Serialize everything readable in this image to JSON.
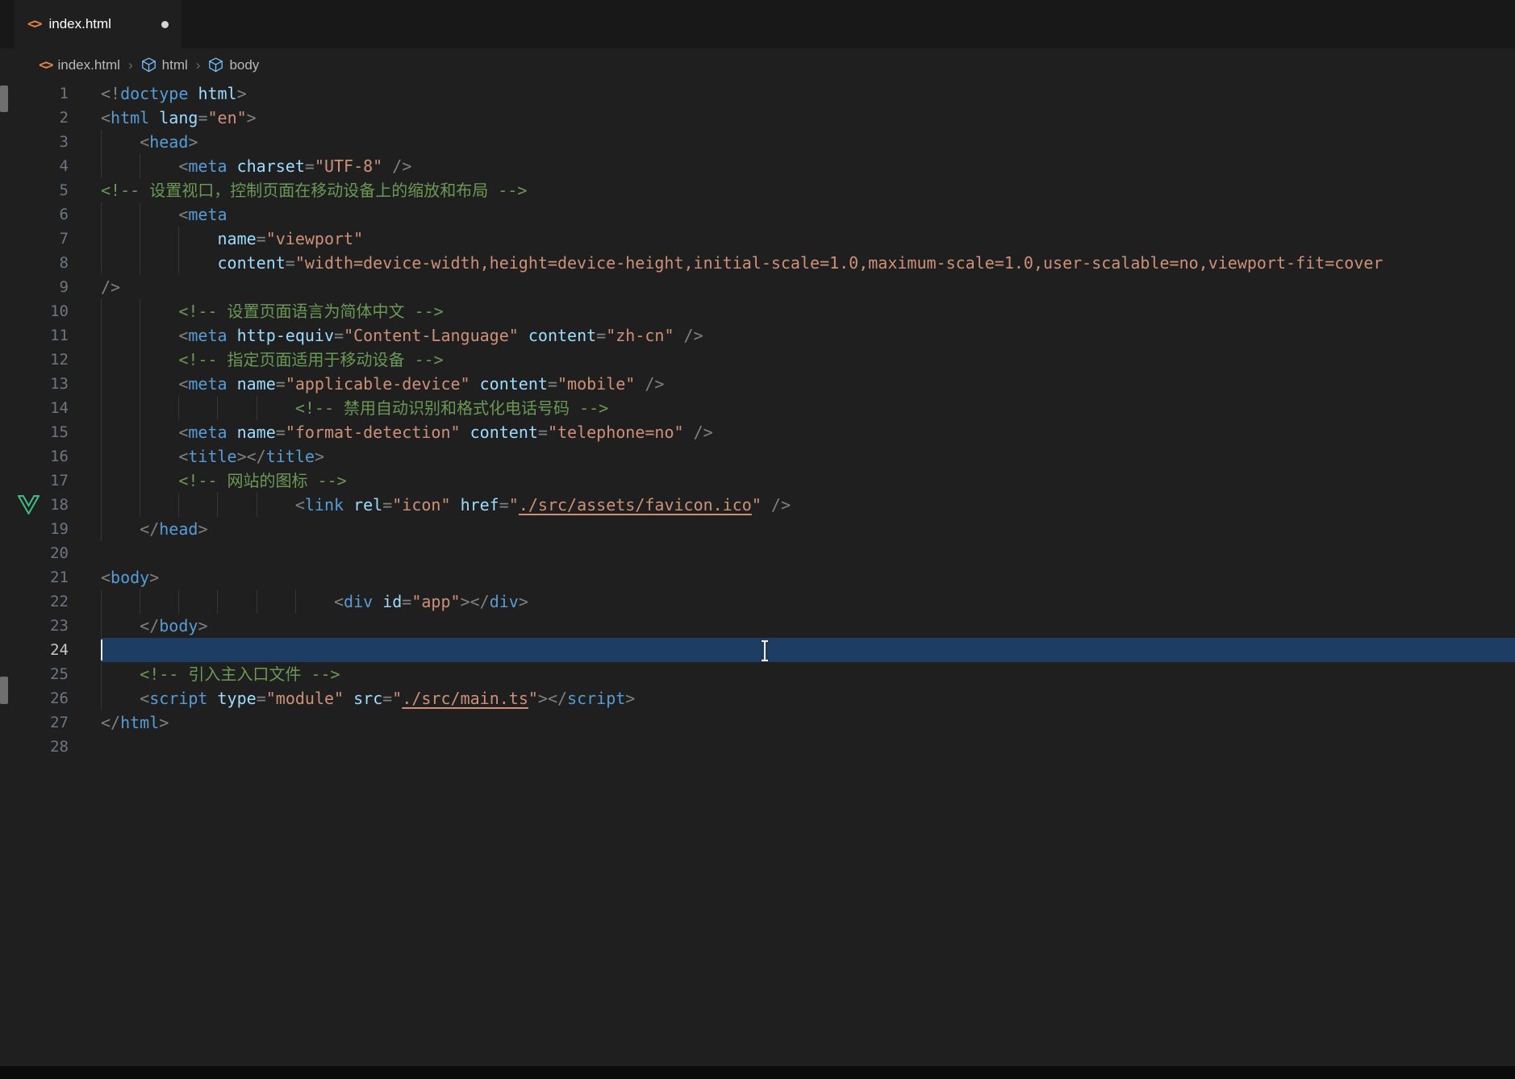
{
  "tab_bar": {
    "tabs": [
      {
        "label": "index.html",
        "modified": true
      }
    ]
  },
  "breadcrumb": {
    "file": "index.html",
    "separator": "›",
    "symbols": [
      "html",
      "body"
    ]
  },
  "ui_colors": {
    "html_file_icon": "#e8824a",
    "vue_gutter_icon": "#42b883",
    "symbol_cube_icon": "#75beff",
    "modified_dot": "#d4d4d4"
  },
  "editor": {
    "language": "html",
    "current_line": 24,
    "caret_col": 0,
    "total_lines": 28,
    "colors": {
      "background": "#1f1f1f",
      "tag": "#569cd6",
      "attribute": "#9cdcfe",
      "string": "#ce9178",
      "punctuation": "#808080",
      "comment": "#6a9955",
      "line_number": "#6e7681",
      "current_line_highlight": "#1d3d63"
    },
    "lines": [
      {
        "n": 1,
        "indent": 0,
        "tokens": [
          [
            "p",
            "<!"
          ],
          [
            "tag",
            "doctype"
          ],
          [
            "tx",
            " "
          ],
          [
            "attr",
            "html"
          ],
          [
            "p",
            ">"
          ]
        ]
      },
      {
        "n": 2,
        "indent": 0,
        "tokens": [
          [
            "p",
            "<"
          ],
          [
            "tag",
            "html"
          ],
          [
            "tx",
            " "
          ],
          [
            "attr",
            "lang"
          ],
          [
            "p",
            "="
          ],
          [
            "str",
            "\"en\""
          ],
          [
            "p",
            ">"
          ]
        ]
      },
      {
        "n": 3,
        "indent": 4,
        "tokens": [
          [
            "p",
            "<"
          ],
          [
            "tag",
            "head"
          ],
          [
            "p",
            ">"
          ]
        ]
      },
      {
        "n": 4,
        "indent": 8,
        "tokens": [
          [
            "p",
            "<"
          ],
          [
            "tag",
            "meta"
          ],
          [
            "tx",
            " "
          ],
          [
            "attr",
            "charset"
          ],
          [
            "p",
            "="
          ],
          [
            "str",
            "\"UTF-8\""
          ],
          [
            "tx",
            " "
          ],
          [
            "p",
            "/>"
          ]
        ]
      },
      {
        "n": 5,
        "indent": 0,
        "tokens": [
          [
            "cm",
            "<!-- 设置视口，控制页面在移动设备上的缩放和布局 -->"
          ]
        ]
      },
      {
        "n": 6,
        "indent": 8,
        "tokens": [
          [
            "p",
            "<"
          ],
          [
            "tag",
            "meta"
          ]
        ]
      },
      {
        "n": 7,
        "indent": 12,
        "tokens": [
          [
            "attr",
            "name"
          ],
          [
            "p",
            "="
          ],
          [
            "str",
            "\"viewport\""
          ]
        ]
      },
      {
        "n": 8,
        "indent": 12,
        "tokens": [
          [
            "attr",
            "content"
          ],
          [
            "p",
            "="
          ],
          [
            "str",
            "\"width=device-width,height=device-height,initial-scale=1.0,maximum-scale=1.0,user-scalable=no,viewport-fit=cover"
          ]
        ]
      },
      {
        "n": 9,
        "indent": 0,
        "tokens": [
          [
            "p",
            "/>"
          ]
        ]
      },
      {
        "n": 10,
        "indent": 8,
        "tokens": [
          [
            "cm",
            "<!-- 设置页面语言为简体中文 -->"
          ]
        ]
      },
      {
        "n": 11,
        "indent": 8,
        "tokens": [
          [
            "p",
            "<"
          ],
          [
            "tag",
            "meta"
          ],
          [
            "tx",
            " "
          ],
          [
            "attr",
            "http-equiv"
          ],
          [
            "p",
            "="
          ],
          [
            "str",
            "\"Content-Language\""
          ],
          [
            "tx",
            " "
          ],
          [
            "attr",
            "content"
          ],
          [
            "p",
            "="
          ],
          [
            "str",
            "\"zh-cn\""
          ],
          [
            "tx",
            " "
          ],
          [
            "p",
            "/>"
          ]
        ]
      },
      {
        "n": 12,
        "indent": 8,
        "tokens": [
          [
            "cm",
            "<!-- 指定页面适用于移动设备 -->"
          ]
        ]
      },
      {
        "n": 13,
        "indent": 8,
        "tokens": [
          [
            "p",
            "<"
          ],
          [
            "tag",
            "meta"
          ],
          [
            "tx",
            " "
          ],
          [
            "attr",
            "name"
          ],
          [
            "p",
            "="
          ],
          [
            "str",
            "\"applicable-device\""
          ],
          [
            "tx",
            " "
          ],
          [
            "attr",
            "content"
          ],
          [
            "p",
            "="
          ],
          [
            "str",
            "\"mobile\""
          ],
          [
            "tx",
            " "
          ],
          [
            "p",
            "/>"
          ]
        ]
      },
      {
        "n": 14,
        "indent": 20,
        "tokens": [
          [
            "cm",
            "<!-- 禁用自动识别和格式化电话号码 -->"
          ]
        ]
      },
      {
        "n": 15,
        "indent": 8,
        "tokens": [
          [
            "p",
            "<"
          ],
          [
            "tag",
            "meta"
          ],
          [
            "tx",
            " "
          ],
          [
            "attr",
            "name"
          ],
          [
            "p",
            "="
          ],
          [
            "str",
            "\"format-detection\""
          ],
          [
            "tx",
            " "
          ],
          [
            "attr",
            "content"
          ],
          [
            "p",
            "="
          ],
          [
            "str",
            "\"telephone=no\""
          ],
          [
            "tx",
            " "
          ],
          [
            "p",
            "/>"
          ]
        ]
      },
      {
        "n": 16,
        "indent": 8,
        "tokens": [
          [
            "p",
            "<"
          ],
          [
            "tag",
            "title"
          ],
          [
            "p",
            "></"
          ],
          [
            "tag",
            "title"
          ],
          [
            "p",
            ">"
          ]
        ]
      },
      {
        "n": 17,
        "indent": 8,
        "tokens": [
          [
            "cm",
            "<!-- 网站的图标 -->"
          ]
        ]
      },
      {
        "n": 18,
        "indent": 20,
        "gutter_icon": "vue",
        "tokens": [
          [
            "p",
            "<"
          ],
          [
            "tag",
            "link"
          ],
          [
            "tx",
            " "
          ],
          [
            "attr",
            "rel"
          ],
          [
            "p",
            "="
          ],
          [
            "str",
            "\"icon\""
          ],
          [
            "tx",
            " "
          ],
          [
            "attr",
            "href"
          ],
          [
            "p",
            "="
          ],
          [
            "str",
            "\""
          ],
          [
            "strU",
            "./src/assets/favicon.ico"
          ],
          [
            "str",
            "\""
          ],
          [
            "tx",
            " "
          ],
          [
            "p",
            "/>"
          ]
        ]
      },
      {
        "n": 19,
        "indent": 4,
        "tokens": [
          [
            "p",
            "</"
          ],
          [
            "tag",
            "head"
          ],
          [
            "p",
            ">"
          ]
        ]
      },
      {
        "n": 20,
        "indent": 0,
        "tokens": []
      },
      {
        "n": 21,
        "indent": 0,
        "tokens": [
          [
            "p",
            "<"
          ],
          [
            "tag",
            "body"
          ],
          [
            "p",
            ">"
          ]
        ]
      },
      {
        "n": 22,
        "indent": 24,
        "tokens": [
          [
            "p",
            "<"
          ],
          [
            "tag",
            "div"
          ],
          [
            "tx",
            " "
          ],
          [
            "attr",
            "id"
          ],
          [
            "p",
            "="
          ],
          [
            "str",
            "\"app\""
          ],
          [
            "p",
            "></"
          ],
          [
            "tag",
            "div"
          ],
          [
            "p",
            ">"
          ]
        ]
      },
      {
        "n": 23,
        "indent": 4,
        "tokens": [
          [
            "p",
            "</"
          ],
          [
            "tag",
            "body"
          ],
          [
            "p",
            ">"
          ]
        ]
      },
      {
        "n": 24,
        "indent": 0,
        "tokens": []
      },
      {
        "n": 25,
        "indent": 4,
        "tokens": [
          [
            "cm",
            "<!-- 引入主入口文件 -->"
          ]
        ]
      },
      {
        "n": 26,
        "indent": 4,
        "tokens": [
          [
            "p",
            "<"
          ],
          [
            "tag",
            "script"
          ],
          [
            "tx",
            " "
          ],
          [
            "attr",
            "type"
          ],
          [
            "p",
            "="
          ],
          [
            "str",
            "\"module\""
          ],
          [
            "tx",
            " "
          ],
          [
            "attr",
            "src"
          ],
          [
            "p",
            "="
          ],
          [
            "str",
            "\""
          ],
          [
            "strU",
            "./src/main.ts"
          ],
          [
            "str",
            "\""
          ],
          [
            "p",
            "></"
          ],
          [
            "tag",
            "script"
          ],
          [
            "p",
            ">"
          ]
        ]
      },
      {
        "n": 27,
        "indent": 0,
        "tokens": [
          [
            "p",
            "</"
          ],
          [
            "tag",
            "html"
          ],
          [
            "p",
            ">"
          ]
        ]
      },
      {
        "n": 28,
        "indent": 0,
        "tokens": []
      }
    ]
  }
}
